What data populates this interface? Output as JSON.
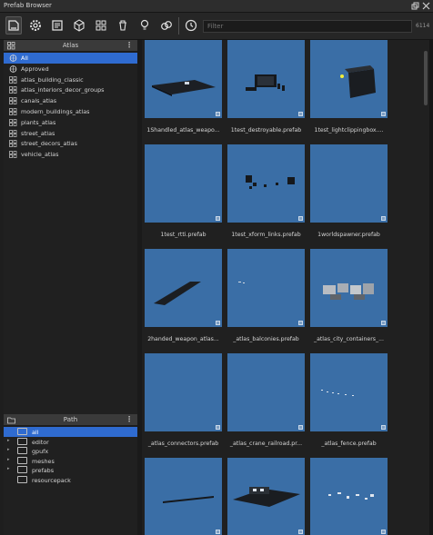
{
  "window": {
    "title": "Prefab Browser",
    "restore_icon": "restore-icon",
    "close_icon": "close-icon"
  },
  "toolbar": {
    "icons": [
      "prefab-icon",
      "gear-icon",
      "document-icon",
      "cube-icon",
      "grid-icon",
      "trash-icon",
      "light-bulb-icon",
      "link-icon",
      "history-icon"
    ],
    "filter_placeholder": "Filter",
    "count": "6114"
  },
  "atlas_panel": {
    "title": "Atlas",
    "items": [
      {
        "label": "All",
        "icon": "globe-icon",
        "selected": true
      },
      {
        "label": "Approved",
        "icon": "globe-icon",
        "selected": false
      },
      {
        "label": "atlas_building_classic",
        "icon": "grid-icon",
        "selected": false
      },
      {
        "label": "atlas_interiors_decor_groups",
        "icon": "grid-icon",
        "selected": false
      },
      {
        "label": "canals_atlas",
        "icon": "grid-icon",
        "selected": false
      },
      {
        "label": "modern_buildings_atlas",
        "icon": "grid-icon",
        "selected": false
      },
      {
        "label": "plants_atlas",
        "icon": "grid-icon",
        "selected": false
      },
      {
        "label": "street_atlas",
        "icon": "grid-icon",
        "selected": false
      },
      {
        "label": "street_decors_atlas",
        "icon": "grid-icon",
        "selected": false
      },
      {
        "label": "vehicle_atlas",
        "icon": "grid-icon",
        "selected": false
      }
    ]
  },
  "path_panel": {
    "title": "Path",
    "items": [
      {
        "label": "all",
        "expandable": false,
        "selected": true
      },
      {
        "label": "editor",
        "expandable": true,
        "selected": false
      },
      {
        "label": "gpufx",
        "expandable": true,
        "selected": false
      },
      {
        "label": "meshes",
        "expandable": true,
        "selected": false
      },
      {
        "label": "prefabs",
        "expandable": true,
        "selected": false
      },
      {
        "label": "resourcepack",
        "expandable": false,
        "selected": false
      }
    ]
  },
  "prefabs": [
    {
      "label": "1Shandled_atlas_weapo...",
      "thumb": "weapon-rack"
    },
    {
      "label": "1test_destroyable.prefab",
      "thumb": "gate"
    },
    {
      "label": "1test_lightclippingbox....",
      "thumb": "dark-box"
    },
    {
      "label": "1test_rtti.prefab",
      "thumb": "empty"
    },
    {
      "label": "1test_xform_links.prefab",
      "thumb": "cubes"
    },
    {
      "label": "1worldspawner.prefab",
      "thumb": "empty"
    },
    {
      "label": "2handed_weapon_atlas...",
      "thumb": "flat-slab"
    },
    {
      "label": "_atlas_balconies.prefab",
      "thumb": "tiny-dots"
    },
    {
      "label": "_atlas_city_containers_...",
      "thumb": "containers"
    },
    {
      "label": "_atlas_connectors.prefab",
      "thumb": "empty"
    },
    {
      "label": "_atlas_crane_railroad.pr...",
      "thumb": "empty"
    },
    {
      "label": "_atlas_fence.prefab",
      "thumb": "fence"
    },
    {
      "label": "",
      "thumb": "long-line"
    },
    {
      "label": "",
      "thumb": "platform"
    },
    {
      "label": "",
      "thumb": "scatter"
    }
  ]
}
